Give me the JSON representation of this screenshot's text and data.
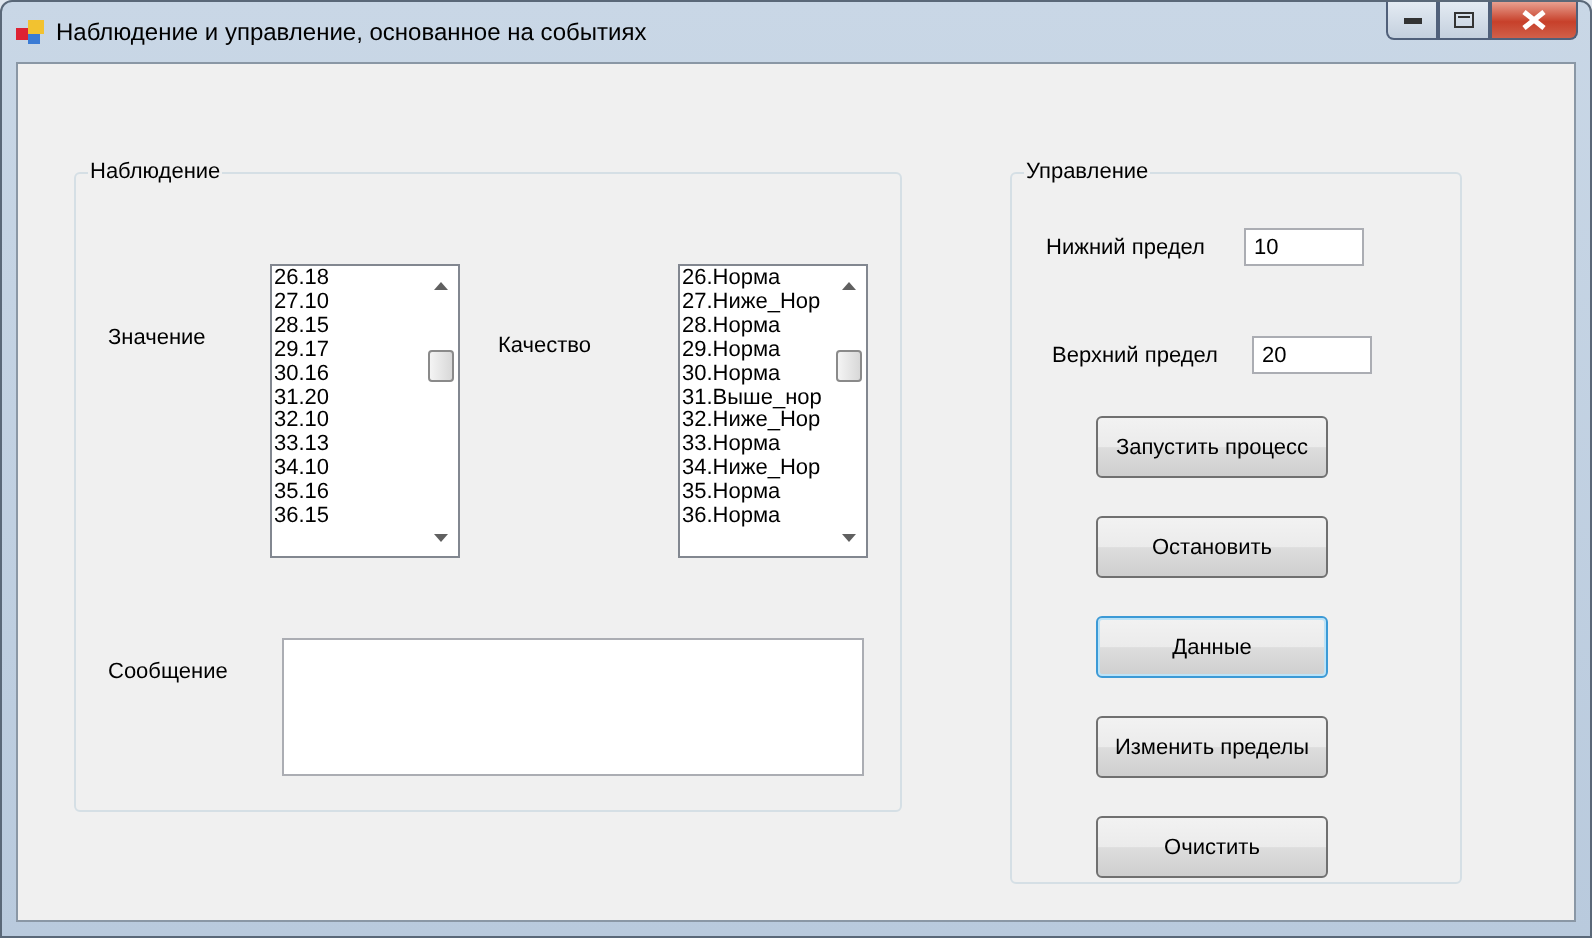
{
  "window": {
    "title": "Наблюдение и управление, основанное на событиях"
  },
  "observation": {
    "title": "Наблюдение",
    "value_label": "Значение",
    "values": [
      "26.18",
      "27.10",
      "28.15",
      "29.17",
      "30.16",
      "31.20",
      "32.10",
      "33.13",
      "34.10",
      "35.16",
      "36.15"
    ],
    "quality_label": "Качество",
    "qualities": [
      "26.Норма",
      "27.Ниже_Нор",
      "28.Норма",
      "29.Норма",
      "30.Норма",
      "31.Выше_нор",
      "32.Ниже_Нор",
      "33.Норма",
      "34.Ниже_Нор",
      "35.Норма",
      "36.Норма"
    ],
    "message_label": "Сообщение"
  },
  "control": {
    "title": "Управление",
    "lower_label": "Нижний предел",
    "lower_value": "10",
    "upper_label": "Верхний предел",
    "upper_value": "20",
    "buttons": [
      {
        "label": "Запустить процесс",
        "focused": false
      },
      {
        "label": "Остановить",
        "focused": false
      },
      {
        "label": "Данные",
        "focused": true
      },
      {
        "label": "Изменить пределы",
        "focused": false
      },
      {
        "label": "Очистить",
        "focused": false
      }
    ]
  }
}
